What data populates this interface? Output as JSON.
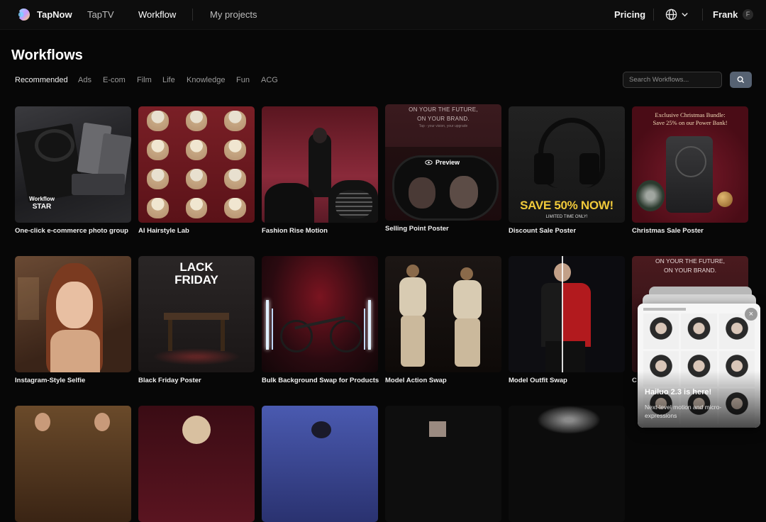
{
  "nav": {
    "brand": "TapNow",
    "items": [
      "TapTV",
      "Workflow",
      "My projects"
    ],
    "pricing": "Pricing",
    "user_name": "Frank",
    "avatar_initial": "F"
  },
  "page": {
    "title": "Workflows",
    "categories": [
      "Recommended",
      "Ads",
      "E-com",
      "Film",
      "Life",
      "Knowledge",
      "Fun",
      "ACG"
    ],
    "active_category": "Recommended",
    "search_placeholder": "Search Workflows..."
  },
  "cards": [
    {
      "title": "One-click e-commerce photo group",
      "badge_line1": "Workflow",
      "badge_line2": "STAR"
    },
    {
      "title": "AI Hairstyle Lab"
    },
    {
      "title": "Fashion Rise Motion"
    },
    {
      "title": "Selling Point Poster",
      "overlay_line1": "ON YOUR THE FUTURE,",
      "overlay_line2": "ON YOUR BRAND.",
      "overlay_line3": "Tap - your vision, your upgrade",
      "preview_label": "Preview"
    },
    {
      "title": "Discount Sale Poster",
      "overlay_line1": "SAVE 50% NOW!",
      "overlay_line2": "LIMITED TIME ONLY!"
    },
    {
      "title": "Christmas Sale Poster",
      "overlay_line1": "Exclusive Christmas Bundle:",
      "overlay_line2": "Save 25% on our Power Bank!"
    },
    {
      "title": "Instagram-Style Selfie"
    },
    {
      "title": "Black Friday Poster",
      "overlay_line1": "LACK",
      "overlay_line2": "FRIDAY"
    },
    {
      "title": "Bulk Background Swap for Products"
    },
    {
      "title": "Model Action Swap"
    },
    {
      "title": "Model Outfit Swap"
    },
    {
      "title": "C",
      "overlay_line1": "ON YOUR THE FUTURE,",
      "overlay_line2": "ON YOUR BRAND."
    }
  ],
  "popup": {
    "title": "Hailuo 2.3 is here!",
    "description": "Next-level motion and micro-expressions",
    "close_label": "×"
  },
  "colors": {
    "background": "#070707",
    "nav_background": "#0d0d0d",
    "search_button": "#566272"
  }
}
